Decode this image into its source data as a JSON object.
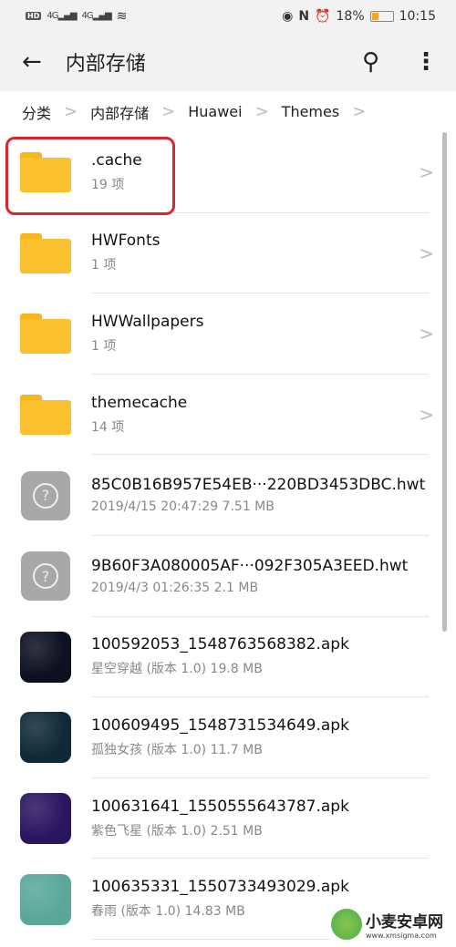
{
  "status_bar": {
    "left": [
      "HD",
      "4G",
      "4G"
    ],
    "battery": "18%",
    "time": "10:15",
    "battery_level": 0.18
  },
  "toolbar": {
    "title": "内部存储",
    "back_icon": "arrow-left",
    "search_icon": "search",
    "more_icon": "more-vertical"
  },
  "breadcrumb": [
    "分类",
    "内部存储",
    "Huawei",
    "Themes"
  ],
  "colors": {
    "folder": "#fbc02d",
    "highlight": "#d9272e"
  },
  "items": [
    {
      "type": "folder",
      "name": ".cache",
      "sub": "19 项",
      "highlighted": true
    },
    {
      "type": "folder",
      "name": "HWFonts",
      "sub": "1 项"
    },
    {
      "type": "folder",
      "name": "HWWallpapers",
      "sub": "1 项"
    },
    {
      "type": "folder",
      "name": "themecache",
      "sub": "14 项"
    },
    {
      "type": "unknown",
      "name": "85C0B16B957E54EB···220BD3453DBC.hwt",
      "sub": "2019/4/15 20:47:29 7.51 MB"
    },
    {
      "type": "unknown",
      "name": "9B60F3A080005AF···092F305A3EED.hwt",
      "sub": "2019/4/3 01:26:35 2.1 MB"
    },
    {
      "type": "apk",
      "name": "100592053_1548763568382.apk",
      "sub": "星空穿越 (版本 1.0) 19.8 MB",
      "thumb": "#0d1020"
    },
    {
      "type": "apk",
      "name": "100609495_1548731534649.apk",
      "sub": "孤独女孩 (版本 1.0) 11.7 MB",
      "thumb": "#0f2a36"
    },
    {
      "type": "apk",
      "name": "100631641_1550555643787.apk",
      "sub": "紫色飞星 (版本 1.0) 2.51 MB",
      "thumb": "#2a1660"
    },
    {
      "type": "apk",
      "name": "100635331_1550733493029.apk",
      "sub": "春雨 (版本 1.0) 14.83 MB",
      "thumb": "#5aa79a"
    }
  ],
  "watermark": {
    "name": "小麦安卓网",
    "url": "www.xmsigma.com"
  }
}
